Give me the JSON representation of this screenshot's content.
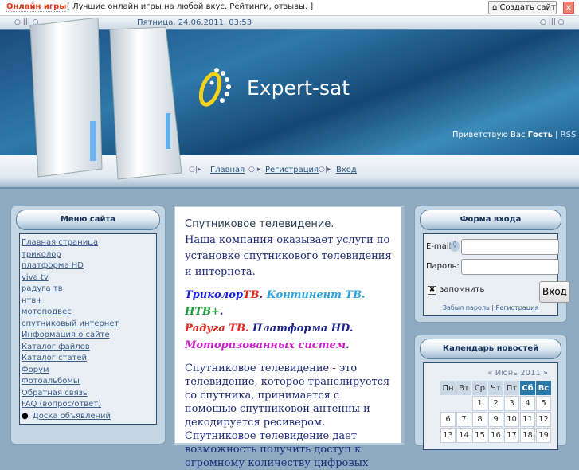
{
  "topbar": {
    "brand": "Онлайн игры",
    "slogan": "[ Лучшие онлайн игры на любой вкус. Рейтинги, отзывы. ]",
    "create_site": "Создать сайт",
    "close": "×"
  },
  "header": {
    "date": "Пятница, 24.06.2011, 03:53",
    "logo": "Expert-sat",
    "greet_prefix": "Приветствую Вас ",
    "greet_user": "Гость",
    "rss": "RSS",
    "ornament": "○ ||| ○"
  },
  "nav": [
    "Главная",
    "Регистрация",
    "Вход"
  ],
  "menu": {
    "title": "Меню сайта",
    "items": [
      "Главная страница",
      "триколор",
      "платформа HD",
      "viva tv",
      "радуга тв",
      "нтв+",
      "мотоподвес",
      "спутниковый интернет",
      "Информация о сайте",
      "Каталог файлов",
      "Каталог статей",
      "Форум",
      "Фотоальбомы",
      "Обратная связь",
      "FAQ (вопрос/ответ)",
      "Доска объявлений"
    ]
  },
  "content": {
    "title": "Спутниковое телевидение.",
    "intro": "Наша компания оказывает услуги по установке спутникового телевидения и интернета.",
    "brands": [
      {
        "t": "Триколор",
        "c": "#1a22e0"
      },
      {
        "t": "ТВ",
        "c": "#e8231c"
      },
      {
        "t": ". ",
        "c": "#1e2a78"
      },
      {
        "t": "Континент ТВ.",
        "c": "#2aa4e0"
      },
      {
        "t": " НТВ+",
        "c": "#1f9a3a"
      },
      {
        "t": ".",
        "c": "#1e2a78"
      },
      {
        "t": "Радуга ТВ.",
        "c": "#e8231c"
      },
      {
        "t": " Платформа HD.",
        "c": "#1a1f8c"
      },
      {
        "t": "Моторизованных систем",
        "c": "#cc22cc"
      },
      {
        "t": ".",
        "c": "#1e2a78"
      }
    ],
    "body": "Спутниковое телевидение - это телевидение, которое транслируется со спутника, принимается с помощью спутниковой антенны и декодируется ресивером. Спутниковое телевидение дает возможность получить доступ к огромному количеству цифровых"
  },
  "login": {
    "title": "Форма входа",
    "email_label": "E-mail:",
    "password_label": "Пароль:",
    "remember": "запомнить",
    "submit": "Вход",
    "forgot": "Забыл пароль",
    "register": "Регистрация",
    "sep": "|"
  },
  "calendar": {
    "title": "Календарь новостей",
    "prev": "«",
    "month": "Июнь 2011",
    "next": "»",
    "days": [
      "Пн",
      "Вт",
      "Ср",
      "Чт",
      "Пт",
      "Сб",
      "Вс"
    ],
    "weeks": [
      [
        "",
        "",
        "1",
        "2",
        "3",
        "4",
        "5"
      ],
      [
        "6",
        "7",
        "8",
        "9",
        "10",
        "11",
        "12"
      ],
      [
        "13",
        "14",
        "15",
        "16",
        "17",
        "18",
        "19"
      ]
    ]
  }
}
